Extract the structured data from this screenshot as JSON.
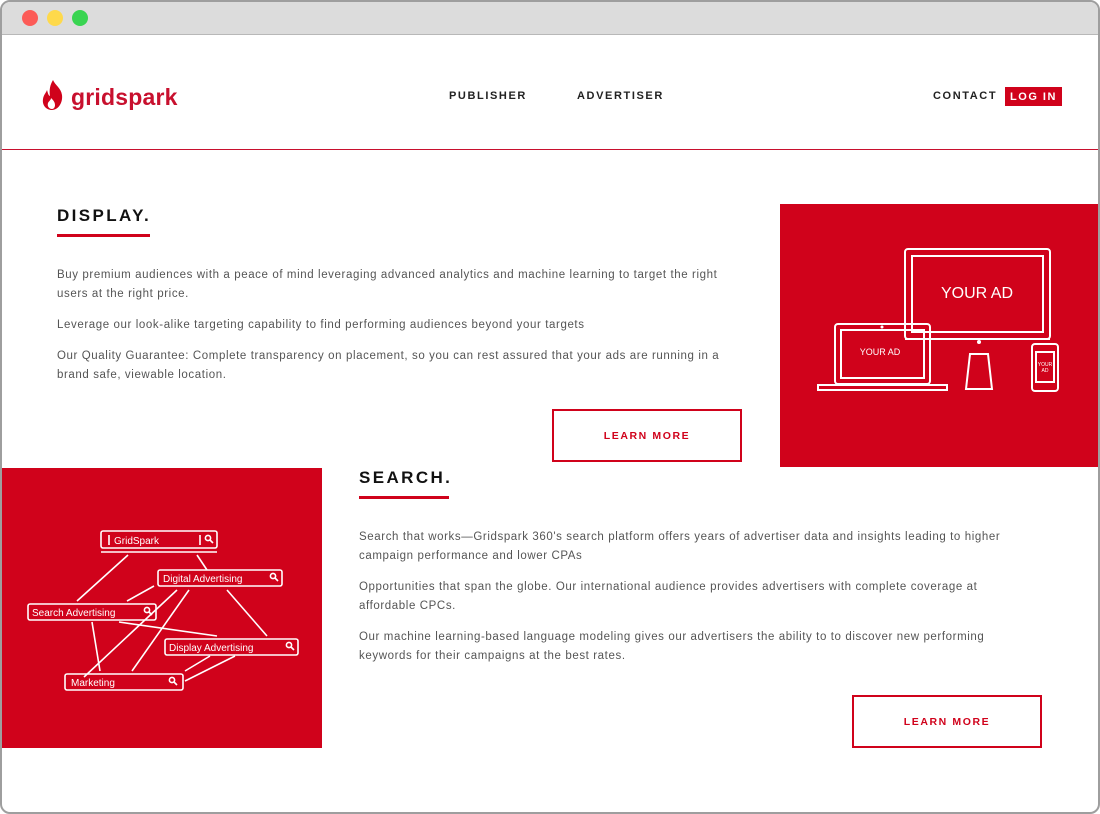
{
  "brand": {
    "name": "gridspark",
    "color": "#d0021b"
  },
  "nav": {
    "links": [
      "PUBLISHER",
      "ADVERTISER"
    ],
    "contact": "CONTACT",
    "login": "LOG IN"
  },
  "display": {
    "title": "DISPLAY.",
    "paragraphs": [
      "Buy premium audiences with a peace of mind leveraging advanced analytics and machine learning to target the right users at the right price.",
      "Leverage our look-alike targeting capability to find performing audiences beyond your targets",
      "Our Quality Guarantee: Complete transparency on placement, so you can rest assured that your ads are running in a brand safe, viewable location."
    ],
    "button": "LEARN MORE",
    "illustration": {
      "monitor_label": "YOUR AD",
      "laptop_label": "YOUR AD",
      "phone_label_line1": "YOUR",
      "phone_label_line2": "AD"
    }
  },
  "search": {
    "title": "SEARCH.",
    "paragraphs": [
      "Search that works—Gridspark 360's search platform offers years of advertiser data and insights leading to higher campaign performance and lower CPAs",
      "Opportunities that span the globe. Our international audience provides advertisers with complete coverage at affordable CPCs.",
      "Our machine learning-based language modeling gives our advertisers the ability to to discover new performing keywords for their campaigns at the best rates."
    ],
    "button": "LEARN MORE",
    "illustration": {
      "boxes": [
        "GridSpark",
        "Digital Advertising",
        "Search Advertising",
        "Display Advertising",
        "Marketing"
      ]
    }
  }
}
